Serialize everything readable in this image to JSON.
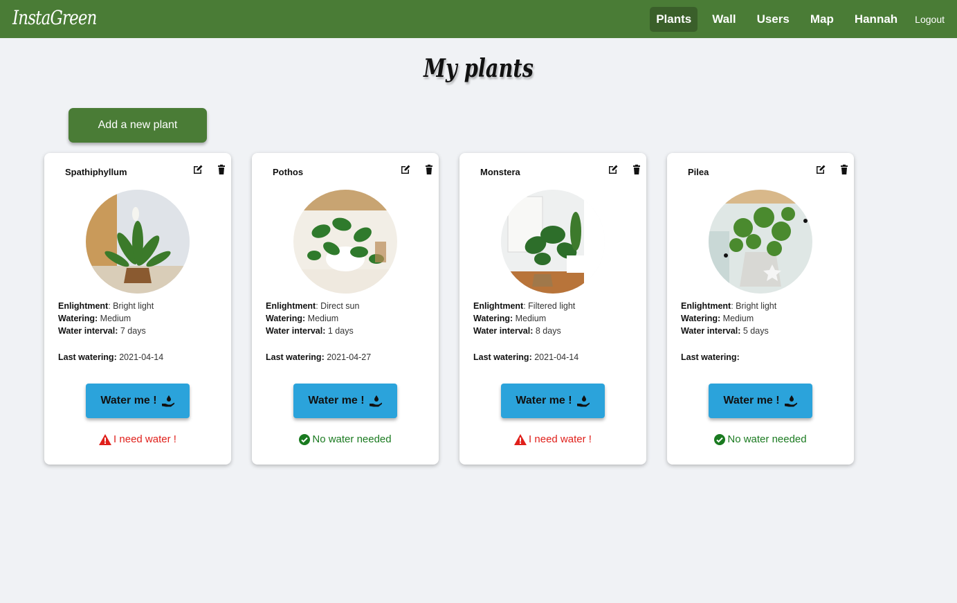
{
  "app": {
    "brand": "InstaGreen"
  },
  "nav": {
    "items": [
      "Plants",
      "Wall",
      "Users",
      "Map",
      "Hannah"
    ],
    "active": "Plants",
    "logout": "Logout"
  },
  "page": {
    "title": "My plants",
    "add_button": "Add a new plant"
  },
  "labels": {
    "enlightment": "Enlightment",
    "watering": "Watering:",
    "interval": "Water interval:",
    "last": "Last watering:",
    "water_button": "Water me !"
  },
  "plants": [
    {
      "name": "Spathiphyllum",
      "enlightment": "Bright light",
      "watering": "Medium",
      "interval": "7 days",
      "last": "2021-04-14",
      "status": "I need water !",
      "status_type": "need"
    },
    {
      "name": "Pothos",
      "enlightment": "Direct sun",
      "watering": "Medium",
      "interval": "1 days",
      "last": "2021-04-27",
      "status": "No water needed",
      "status_type": "ok"
    },
    {
      "name": "Monstera",
      "enlightment": "Filtered light",
      "watering": "Medium",
      "interval": "8 days",
      "last": "2021-04-14",
      "status": "I need water !",
      "status_type": "need"
    },
    {
      "name": "Pilea",
      "enlightment": "Bright light",
      "watering": "Medium",
      "interval": "5 days",
      "last": "",
      "status": "No water needed",
      "status_type": "ok"
    }
  ],
  "colors": {
    "navbar": "#4a7c36",
    "water_button": "#2ba3db",
    "need": "#e0201b",
    "ok": "#1a7a20"
  }
}
